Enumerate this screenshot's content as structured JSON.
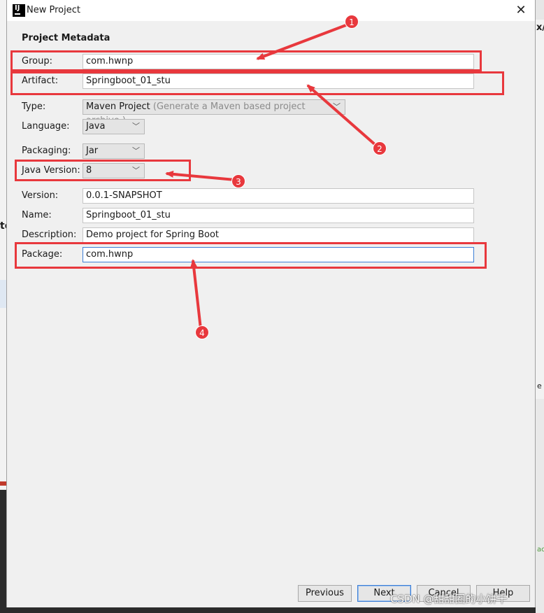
{
  "dialog": {
    "title": "New Project",
    "close_glyph": "✕"
  },
  "section_title": "Project Metadata",
  "fields": {
    "group": {
      "label": "Group:",
      "value": "com.hwnp"
    },
    "artifact": {
      "label": "Artifact:",
      "value": "Springboot_01_stu"
    },
    "type": {
      "label": "Type:",
      "value": "Maven Project",
      "hint": "(Generate a Maven based project archive.)"
    },
    "language": {
      "label": "Language:",
      "value": "Java"
    },
    "packaging": {
      "label": "Packaging:",
      "value": "Jar"
    },
    "java_version": {
      "label": "Java Version:",
      "value": "8"
    },
    "version": {
      "label": "Version:",
      "value": "0.0.1-SNAPSHOT"
    },
    "name": {
      "label": "Name:",
      "value": "Springboot_01_stu"
    },
    "description": {
      "label": "Description:",
      "value": "Demo project for Spring Boot"
    },
    "package": {
      "label": "Package:",
      "value": "com.hwnp"
    }
  },
  "buttons": {
    "previous": "Previous",
    "next": "Next",
    "cancel": "Cancel",
    "help": "Help"
  },
  "annotations": [
    "1",
    "2",
    "3",
    "4"
  ],
  "watermark": "CSDN @甜甜圈的小饼干",
  "colors": {
    "annotation_red": "#e8383d",
    "focus_blue": "#3d7fd6"
  },
  "icons": {
    "chevron": "chevron-down-icon",
    "app": "intellij-icon",
    "close": "close-icon"
  }
}
